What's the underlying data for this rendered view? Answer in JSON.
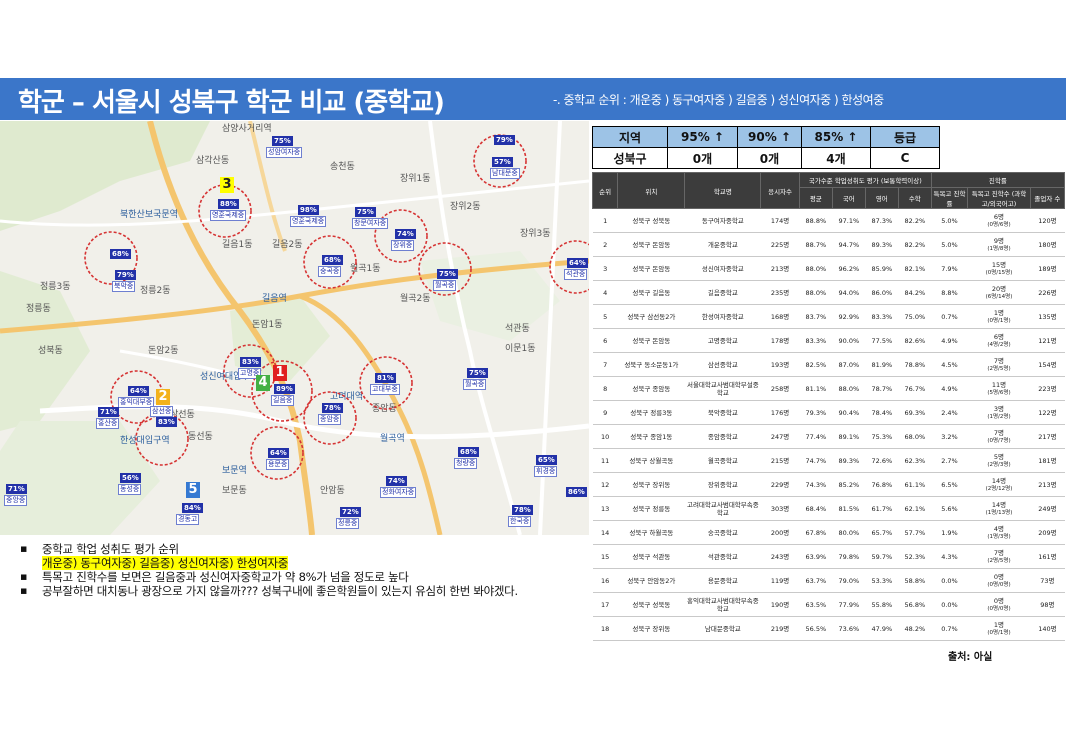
{
  "header": {
    "title": "학군 – 서울시 성북구 학군 비교 (중학교)",
    "subtitle": "-. 중학교 순위 : 개운중 ) 동구여자중 ) 길음중 ) 성신여자중 ) 한성여중"
  },
  "summary_table": {
    "headers": [
      "지역",
      "95% ↑",
      "90% ↑",
      "85% ↑",
      "등급"
    ],
    "row": [
      "성북구",
      "0개",
      "0개",
      "4개",
      "C"
    ]
  },
  "detail_table": {
    "header_top": [
      "순위",
      "위치",
      "학교명",
      "응시자수",
      "국가수준 학업성취도 평가 (보통학력이상)",
      "진학률"
    ],
    "header_sub": [
      "평균",
      "국어",
      "영어",
      "수학",
      "특목고 진학률",
      "특목고 진학수 (과학고/외국어고)",
      "졸업자 수"
    ],
    "rows": [
      {
        "rank": "1",
        "loc": "성북구 성북동",
        "school": "동구여자중학교",
        "n": "174명",
        "avg": "88.8%",
        "kor": "97.1%",
        "eng": "87.3%",
        "math": "82.2%",
        "rate": "5.0%",
        "cnt": "6명",
        "cnt2": "(0명/6명)",
        "grad": "120명"
      },
      {
        "rank": "2",
        "loc": "성북구 돈암동",
        "school": "개운중학교",
        "n": "225명",
        "avg": "88.7%",
        "kor": "94.7%",
        "eng": "89.3%",
        "math": "82.2%",
        "rate": "5.0%",
        "cnt": "9명",
        "cnt2": "(1명/8명)",
        "grad": "180명"
      },
      {
        "rank": "3",
        "loc": "성북구 돈암동",
        "school": "성신여자중학교",
        "n": "213명",
        "avg": "88.0%",
        "kor": "96.2%",
        "eng": "85.9%",
        "math": "82.1%",
        "rate": "7.9%",
        "cnt": "15명",
        "cnt2": "(0명/15명)",
        "grad": "189명"
      },
      {
        "rank": "4",
        "loc": "성북구 길음동",
        "school": "길음중학교",
        "n": "235명",
        "avg": "88.0%",
        "kor": "94.0%",
        "eng": "86.0%",
        "math": "84.2%",
        "rate": "8.8%",
        "cnt": "20명",
        "cnt2": "(6명/14명)",
        "grad": "226명"
      },
      {
        "rank": "5",
        "loc": "성북구 삼선동2가",
        "school": "한성여자중학교",
        "n": "168명",
        "avg": "83.7%",
        "kor": "92.9%",
        "eng": "83.3%",
        "math": "75.0%",
        "rate": "0.7%",
        "cnt": "1명",
        "cnt2": "(0명/1명)",
        "grad": "135명"
      },
      {
        "rank": "6",
        "loc": "성북구 돈암동",
        "school": "고명중학교",
        "n": "178명",
        "avg": "83.3%",
        "kor": "90.0%",
        "eng": "77.5%",
        "math": "82.6%",
        "rate": "4.9%",
        "cnt": "6명",
        "cnt2": "(4명/2명)",
        "grad": "121명"
      },
      {
        "rank": "7",
        "loc": "성북구 동소문동1가",
        "school": "삼선중학교",
        "n": "193명",
        "avg": "82.5%",
        "kor": "87.0%",
        "eng": "81.9%",
        "math": "78.8%",
        "rate": "4.5%",
        "cnt": "7명",
        "cnt2": "(2명/5명)",
        "grad": "154명"
      },
      {
        "rank": "8",
        "loc": "성북구 종암동",
        "school": "서울대학교사범대학부설중학교",
        "n": "258명",
        "avg": "81.1%",
        "kor": "88.0%",
        "eng": "78.7%",
        "math": "76.7%",
        "rate": "4.9%",
        "cnt": "11명",
        "cnt2": "(5명/6명)",
        "grad": "223명"
      },
      {
        "rank": "9",
        "loc": "성북구 정릉3동",
        "school": "북악중학교",
        "n": "176명",
        "avg": "79.3%",
        "kor": "90.4%",
        "eng": "78.4%",
        "math": "69.3%",
        "rate": "2.4%",
        "cnt": "3명",
        "cnt2": "(1명/2명)",
        "grad": "122명"
      },
      {
        "rank": "10",
        "loc": "성북구 종암1동",
        "school": "종암중학교",
        "n": "247명",
        "avg": "77.4%",
        "kor": "89.1%",
        "eng": "75.3%",
        "math": "68.0%",
        "rate": "3.2%",
        "cnt": "7명",
        "cnt2": "(0명/7명)",
        "grad": "217명"
      },
      {
        "rank": "11",
        "loc": "성북구 상월곡동",
        "school": "월곡중학교",
        "n": "215명",
        "avg": "74.7%",
        "kor": "89.3%",
        "eng": "72.6%",
        "math": "62.3%",
        "rate": "2.7%",
        "cnt": "5명",
        "cnt2": "(2명/3명)",
        "grad": "181명"
      },
      {
        "rank": "12",
        "loc": "성북구 장위동",
        "school": "장위중학교",
        "n": "229명",
        "avg": "74.3%",
        "kor": "85.2%",
        "eng": "76.8%",
        "math": "61.1%",
        "rate": "6.5%",
        "cnt": "14명",
        "cnt2": "(2명/12명)",
        "grad": "213명"
      },
      {
        "rank": "13",
        "loc": "성북구 정릉동",
        "school": "고려대학교사범대학부속중학교",
        "n": "303명",
        "avg": "68.4%",
        "kor": "81.5%",
        "eng": "61.7%",
        "math": "62.1%",
        "rate": "5.6%",
        "cnt": "14명",
        "cnt2": "(1명/13명)",
        "grad": "249명"
      },
      {
        "rank": "14",
        "loc": "성북구 하월곡동",
        "school": "숭곡중학교",
        "n": "200명",
        "avg": "67.8%",
        "kor": "80.0%",
        "eng": "65.7%",
        "math": "57.7%",
        "rate": "1.9%",
        "cnt": "4명",
        "cnt2": "(1명/3명)",
        "grad": "209명"
      },
      {
        "rank": "15",
        "loc": "성북구 석관동",
        "school": "석관중학교",
        "n": "243명",
        "avg": "63.9%",
        "kor": "79.8%",
        "eng": "59.7%",
        "math": "52.3%",
        "rate": "4.3%",
        "cnt": "7명",
        "cnt2": "(2명/5명)",
        "grad": "161명"
      },
      {
        "rank": "16",
        "loc": "성북구 안암동2가",
        "school": "용문중학교",
        "n": "119명",
        "avg": "63.7%",
        "kor": "79.0%",
        "eng": "53.3%",
        "math": "58.8%",
        "rate": "0.0%",
        "cnt": "0명",
        "cnt2": "(0명/0명)",
        "grad": "73명"
      },
      {
        "rank": "17",
        "loc": "성북구 성북동",
        "school": "홍익대학교사범대학부속중학교",
        "n": "190명",
        "avg": "63.5%",
        "kor": "77.9%",
        "eng": "55.8%",
        "math": "56.8%",
        "rate": "0.0%",
        "cnt": "0명",
        "cnt2": "(0명/0명)",
        "grad": "98명"
      },
      {
        "rank": "18",
        "loc": "성북구 장위동",
        "school": "남대문중학교",
        "n": "219명",
        "avg": "56.5%",
        "kor": "73.6%",
        "eng": "47.9%",
        "math": "48.2%",
        "rate": "0.7%",
        "cnt": "1명",
        "cnt2": "(0명/1명)",
        "grad": "140명"
      }
    ]
  },
  "map": {
    "labels": [
      "삼양사거리역",
      "삼각산동",
      "송천동",
      "장위1동",
      "장위2동",
      "장위3동",
      "북한산보국문역",
      "정릉3동",
      "길음1동",
      "길음2동",
      "길음역",
      "정릉2동",
      "성신여대입구역",
      "돈암1동",
      "돈암2동",
      "월곡1동",
      "월곡2동",
      "석관동",
      "종암동",
      "안암동",
      "보문역",
      "보문동",
      "성북동",
      "정릉동",
      "이문1동",
      "한성대입구역",
      "삼선동",
      "동선동",
      "월곡역",
      "고려대역"
    ],
    "markers": [
      {
        "pct": "75%",
        "school": "성암여자중"
      },
      {
        "pct": "79%",
        "school": "남대문중"
      },
      {
        "pct": "57%",
        "school": ""
      },
      {
        "pct": "88%",
        "school": "영훈국제중"
      },
      {
        "pct": "98%",
        "school": "영훈국제중"
      },
      {
        "pct": "75%",
        "school": "창문여자중"
      },
      {
        "pct": "74%",
        "school": "장위중"
      },
      {
        "pct": "68%",
        "school": "숭곡중"
      },
      {
        "pct": "75%",
        "school": "월곡중"
      },
      {
        "pct": "64%",
        "school": "석관중"
      },
      {
        "pct": "68%",
        "school": ""
      },
      {
        "pct": "79%",
        "school": "북악중"
      },
      {
        "pct": "83%",
        "school": "고명중"
      },
      {
        "pct": "89%",
        "school": "길음중"
      },
      {
        "pct": "81%",
        "school": "고대부중"
      },
      {
        "pct": "75%",
        "school": "월곡중"
      },
      {
        "pct": "64%",
        "school": "홍익대부중"
      },
      {
        "pct": "71%",
        "school": "홍산중"
      },
      {
        "pct": "83%",
        "school": "삼선중"
      },
      {
        "pct": "78%",
        "school": "종암중"
      },
      {
        "pct": "64%",
        "school": "용문중"
      },
      {
        "pct": "56%",
        "school": "동성중"
      },
      {
        "pct": "84%",
        "school": "경동고"
      },
      {
        "pct": "74%",
        "school": "정화여자중"
      },
      {
        "pct": "68%",
        "school": "청량중"
      },
      {
        "pct": "65%",
        "school": "휘경중"
      },
      {
        "pct": "86%",
        "school": ""
      },
      {
        "pct": "72%",
        "school": "정릉중"
      },
      {
        "pct": "71%",
        "school": "중앙중"
      },
      {
        "pct": "78%",
        "school": "한국중"
      }
    ],
    "ranks": [
      "3",
      "1",
      "4",
      "2",
      "5"
    ]
  },
  "bullets": {
    "b1": "중학교 학업 성취도 평가 순위",
    "b1_sub": "개운중) 동구여자중) 길음중) 성신여자중) 한성여자중",
    "b2": "특목고 진학수를 보면은 길음중과 성신여자중학교가 약 8%가 넘을 정도로  높다",
    "b3": "공부잘하면 대치동나 광장으로 가지 않을까??? 성북구내에 좋은학원들이 있는지 유심히 한번 봐야겠다."
  },
  "source": "출처: 아실"
}
